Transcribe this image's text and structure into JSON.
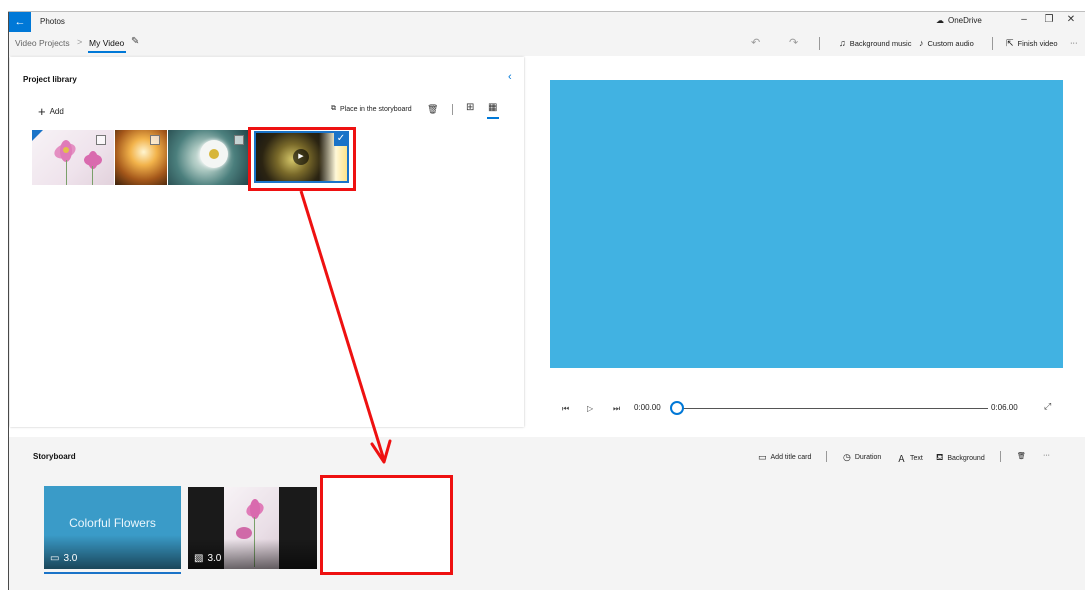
{
  "titlebar": {
    "app_title": "Photos",
    "back_icon": "back-arrow-icon",
    "onedrive_label": "OneDrive",
    "minimize_glyph": "–",
    "maximize_glyph": "❐",
    "close_glyph": "✕"
  },
  "breadcrumb": {
    "parent": "Video Projects",
    "separator": ">",
    "current": "My Video"
  },
  "toolbar": {
    "background_music": "Background music",
    "custom_audio": "Custom audio",
    "finish_video": "Finish video",
    "more": "···"
  },
  "library": {
    "title": "Project library",
    "add_label": "Add",
    "place_label": "Place in the storyboard",
    "items": [
      {
        "name": "pink-flowers",
        "checked": false
      },
      {
        "name": "dandelion",
        "checked": false
      },
      {
        "name": "daisy",
        "checked": false
      },
      {
        "name": "pinecone-video",
        "checked": true
      }
    ]
  },
  "preview": {
    "color": "#41b2e2",
    "current_time": "0:00.00",
    "total_time": "0:06.00",
    "progress": 0
  },
  "storyboard": {
    "title": "Storyboard",
    "add_title_card": "Add title card",
    "duration": "Duration",
    "text": "Text",
    "background": "Background",
    "more": "···",
    "cards": [
      {
        "title": "Colorful Flowers",
        "duration": "3.0",
        "color": "#3a9bc8"
      },
      {
        "duration": "3.0"
      }
    ]
  },
  "colors": {
    "accent": "#0078d7",
    "annotation": "#ee1111"
  }
}
